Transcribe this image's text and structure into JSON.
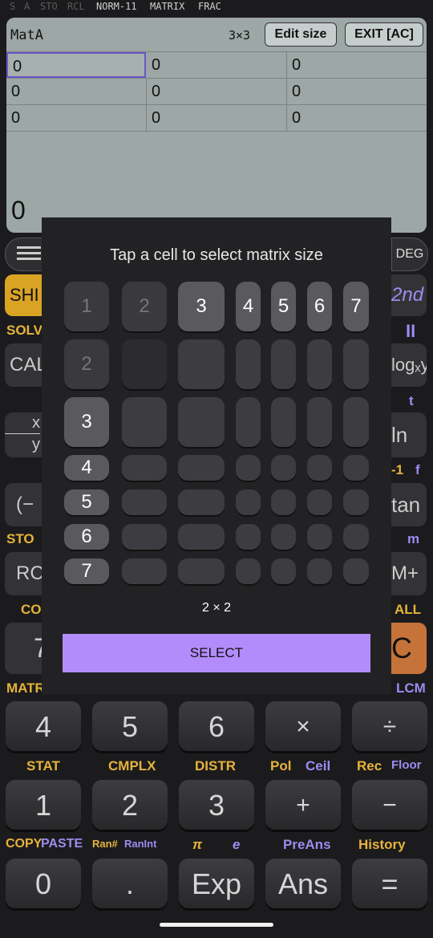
{
  "status_bar": {
    "dim": [
      "S",
      "A",
      "STO",
      "RCL"
    ],
    "modes": [
      "NORM-11",
      "MATRIX",
      "FRAC"
    ]
  },
  "display": {
    "matrix_name": "MatA",
    "dimension": "3×3",
    "edit_size_label": "Edit size",
    "exit_label": "EXIT [AC]",
    "cells": [
      [
        "0",
        "0",
        "0"
      ],
      [
        "0",
        "0",
        "0"
      ],
      [
        "0",
        "0",
        "0"
      ]
    ],
    "result": "0"
  },
  "dialog": {
    "title": "Tap a cell to select matrix size",
    "col_headers": [
      "1",
      "2",
      "3",
      "4",
      "5",
      "6",
      "7"
    ],
    "row_headers": [
      "2",
      "3",
      "4",
      "5",
      "6",
      "7"
    ],
    "selected_size": "2 × 2",
    "select_label": "SELECT"
  },
  "left_edge": {
    "shift": "SHI",
    "solve": "SOLV",
    "calc": "CAL",
    "frac_a": "x",
    "frac_b": "y",
    "neg": "(−",
    "sto": "STO",
    "rcl": "RC",
    "conv": "CO",
    "seven": "7",
    "matrix": "MATR"
  },
  "right_edge": {
    "deg": "DEG",
    "second": "2nd",
    "roman": "II",
    "log": "logₓy",
    "t": "t",
    "ln": "ln",
    "inv": "-1",
    "f": "f",
    "tan": "tan",
    "m": "m",
    "mplus": "M+",
    "all": "ALL",
    "ac": "C",
    "lcm": "LCM"
  },
  "keypad": {
    "row1": [
      "4",
      "5",
      "6",
      "×",
      "÷"
    ],
    "labels1": [
      [
        "STAT",
        ""
      ],
      [
        "CMPLX",
        ""
      ],
      [
        "DISTR",
        ""
      ],
      [
        "Pol",
        "Ceil"
      ],
      [
        "Rec",
        "Floor"
      ]
    ],
    "row2": [
      "1",
      "2",
      "3",
      "+",
      "−"
    ],
    "labels2": [
      [
        "COPY",
        "PASTE"
      ],
      [
        "Ran#",
        "RanInt"
      ],
      [
        "π",
        "e"
      ],
      [
        "",
        "PreAns"
      ],
      [
        "History",
        ""
      ]
    ],
    "row3": [
      "0",
      ".",
      "Exp",
      "Ans",
      "="
    ]
  }
}
